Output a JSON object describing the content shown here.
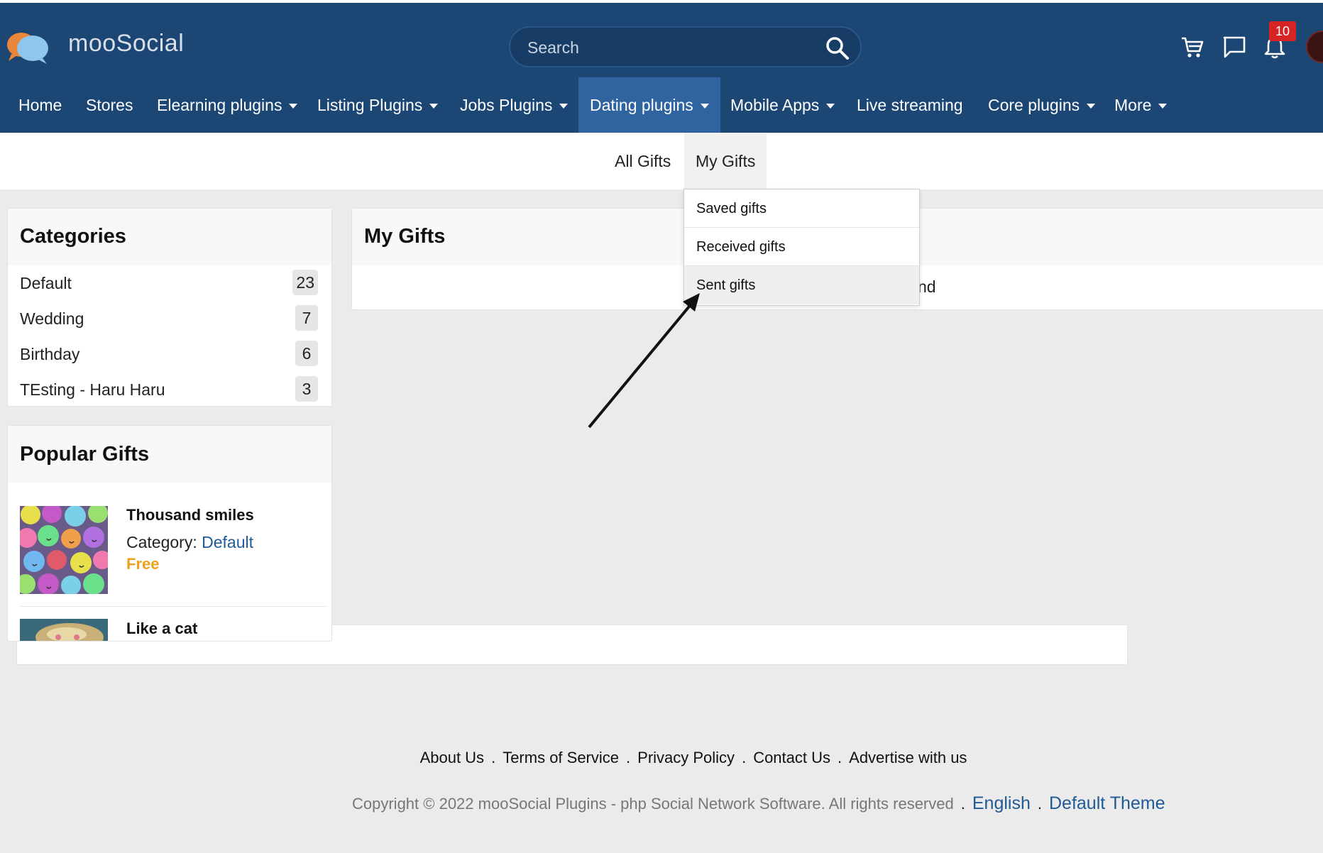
{
  "brand": {
    "name": "mooSocial"
  },
  "search": {
    "placeholder": "Search"
  },
  "header": {
    "notification_count": "10"
  },
  "nav": {
    "items": [
      {
        "label": "Home"
      },
      {
        "label": "Stores"
      },
      {
        "label": "Elearning plugins"
      },
      {
        "label": "Listing Plugins"
      },
      {
        "label": "Jobs Plugins"
      },
      {
        "label": "Dating plugins"
      },
      {
        "label": "Mobile Apps"
      },
      {
        "label": "Live streaming"
      },
      {
        "label": "Core plugins"
      },
      {
        "label": "More"
      }
    ]
  },
  "subnav": {
    "all_gifts": "All Gifts",
    "my_gifts": "My Gifts"
  },
  "dropdown": {
    "items": [
      {
        "label": "Saved gifts"
      },
      {
        "label": "Received gifts"
      },
      {
        "label": "Sent gifts"
      }
    ]
  },
  "categories": {
    "title": "Categories",
    "items": [
      {
        "name": "Default",
        "count": "23"
      },
      {
        "name": "Wedding",
        "count": "7"
      },
      {
        "name": "Birthday",
        "count": "6"
      },
      {
        "name": "TEsting - Haru Haru",
        "count": "3"
      }
    ]
  },
  "popular": {
    "title": "Popular Gifts",
    "items": [
      {
        "title": "Thousand smiles",
        "category_label": "Category: ",
        "category": "Default",
        "price": "Free"
      },
      {
        "title": "Like a cat"
      }
    ]
  },
  "main": {
    "title": "My Gifts",
    "partial_text": "nd"
  },
  "footer": {
    "links": [
      "About Us",
      "Terms of Service",
      "Privacy Policy",
      "Contact Us",
      "Advertise with us"
    ],
    "copyright": "Copyright © 2022 mooSocial Plugins - php Social Network Software. All rights reserved",
    "language": "English",
    "theme": "Default Theme"
  },
  "colors": {
    "header": "#1c4674",
    "active_nav": "#2f64a0",
    "link": "#1f5a96",
    "free": "#f0a020"
  }
}
